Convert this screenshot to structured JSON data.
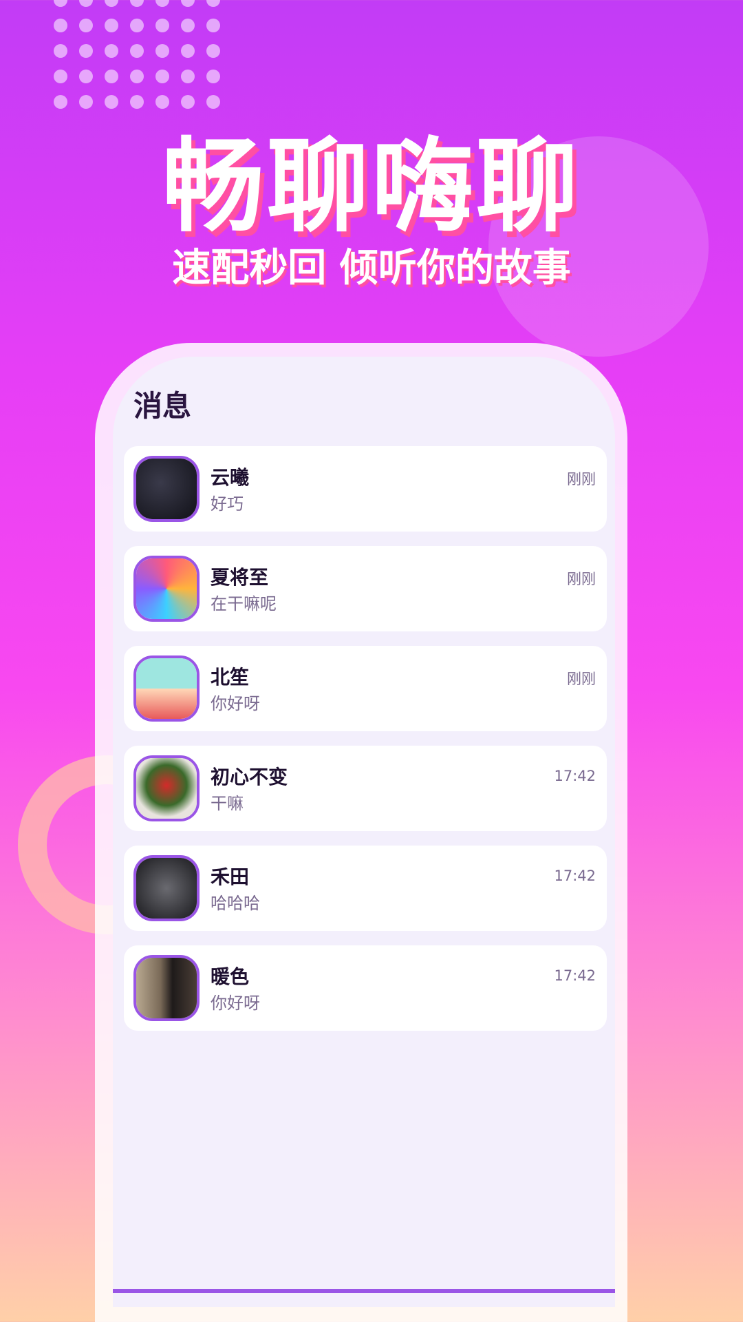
{
  "headline": "畅聊嗨聊",
  "subheadline": "速配秒回 倾听你的故事",
  "screen": {
    "title": "消息",
    "conversations": [
      {
        "name": "云曦",
        "message": "好巧",
        "time": "刚刚"
      },
      {
        "name": "夏将至",
        "message": "在干嘛呢",
        "time": "刚刚"
      },
      {
        "name": "北笙",
        "message": "你好呀",
        "time": "刚刚"
      },
      {
        "name": "初心不变",
        "message": "干嘛",
        "time": "17:42"
      },
      {
        "name": "禾田",
        "message": "哈哈哈",
        "time": "17:42"
      },
      {
        "name": "暖色",
        "message": "你好呀",
        "time": "17:42"
      }
    ]
  },
  "colors": {
    "accent": "#9a55e6",
    "background_top": "#c23cf6",
    "background_bottom": "#ffd0a8",
    "headline_shadow": "#ff4fa3"
  }
}
